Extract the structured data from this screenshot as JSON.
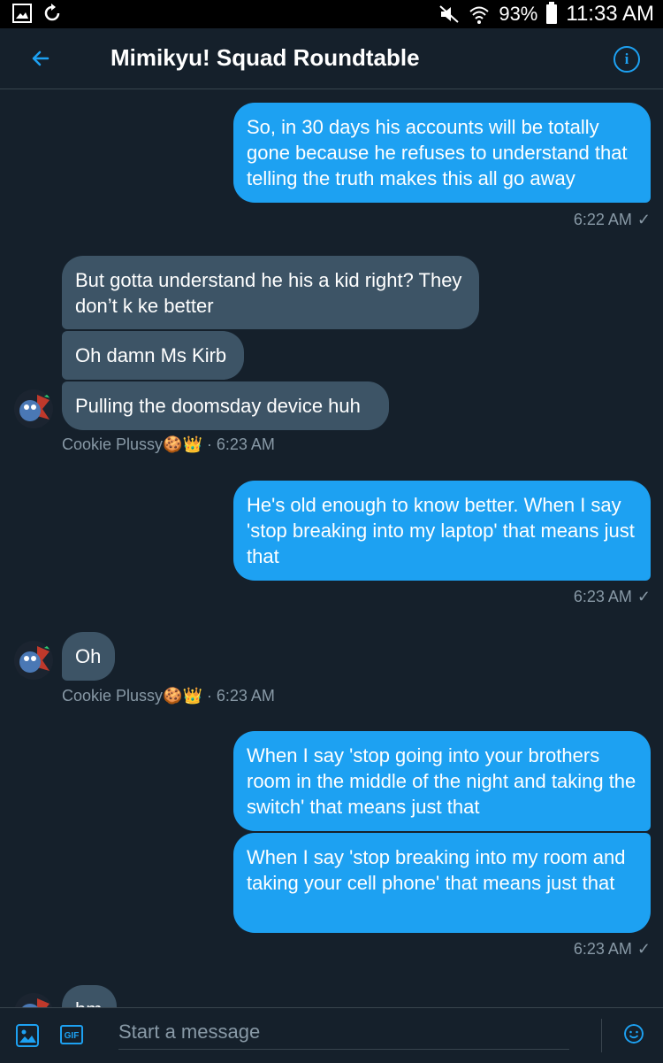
{
  "status": {
    "battery": "93%",
    "time": "11:33 AM"
  },
  "header": {
    "title": "Mimikyu! Squad Roundtable"
  },
  "messages": {
    "m1": "So, in 30 days his accounts will be totally gone because he refuses to understand that telling the truth makes this all go away",
    "t1": "6:22 AM",
    "m2": "But gotta understand he his a kid right? They don’t k ke better",
    "m3": "Oh damn Ms Kirb",
    "m4": "Pulling the doomsday device huh",
    "sender1": "Cookie Plussy🍪👑 · 6:23 AM",
    "m5": "He's old enough to know better. When I say 'stop breaking into my laptop' that means just that",
    "t5": "6:23 AM",
    "m6": "Oh",
    "sender2": "Cookie Plussy🍪👑 · 6:23 AM",
    "m7": "When I say 'stop going into your brothers room in the middle of the night and taking the switch' that means just that",
    "m8": "When I say 'stop breaking into my room and taking your cell phone' that means just that",
    "t8": "6:23 AM",
    "m9": "hm"
  },
  "composer": {
    "placeholder": "Start a message",
    "gif_label": "GIF"
  }
}
